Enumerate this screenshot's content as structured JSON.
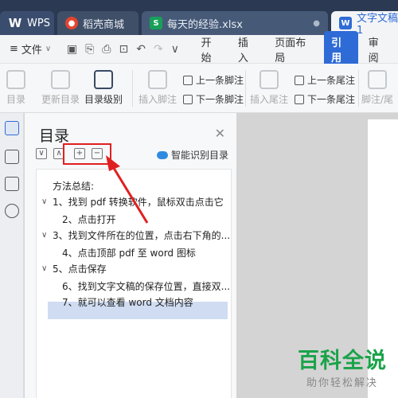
{
  "tabs": {
    "wps": "WPS",
    "daoke": "稻壳商城",
    "xlsx": "每天的经验.xlsx",
    "doc": "文字文稿1"
  },
  "menubar": {
    "file": "文件",
    "items": [
      "开始",
      "插入",
      "页面布局",
      "引用",
      "审阅"
    ],
    "active": "引用"
  },
  "ribbon": {
    "toc": "目录",
    "update_toc": "更新目录",
    "toc_level": "目录级别",
    "insert_footnote": "插入脚注",
    "prev_footnote": "上一条脚注",
    "next_footnote": "下一条脚注",
    "insert_endnote": "插入尾注",
    "prev_endnote": "上一条尾注",
    "next_endnote": "下一条尾注",
    "footnote_endnote": "脚注/尾"
  },
  "panel": {
    "title": "目录",
    "ai_label": "智能识别目录",
    "expand_symbol": "+",
    "collapse_symbol": "−",
    "items": [
      {
        "text": "方法总结:",
        "indent": 1,
        "caret": ""
      },
      {
        "text": "1、找到 pdf 转换软件，鼠标双击点击它",
        "indent": 0,
        "caret": "∨"
      },
      {
        "text": "2、点击打开",
        "indent": 2,
        "caret": ""
      },
      {
        "text": "3、找到文件所在的位置，点击右下角的...",
        "indent": 0,
        "caret": "∨"
      },
      {
        "text": "4、点击顶部 pdf 至 word 图标",
        "indent": 2,
        "caret": ""
      },
      {
        "text": "5、点击保存",
        "indent": 0,
        "caret": "∨"
      },
      {
        "text": "6、找到文字文稿的保存位置，直接双...",
        "indent": 2,
        "caret": ""
      },
      {
        "text": "7、就可以查看 word 文档内容",
        "indent": 2,
        "caret": ""
      }
    ]
  },
  "colors": {
    "accent": "#2f6bd6",
    "highlight": "#e02020",
    "watermark": "#1aa34a"
  },
  "watermark": {
    "title": "百科全说",
    "subtitle": "助你轻松解决"
  }
}
